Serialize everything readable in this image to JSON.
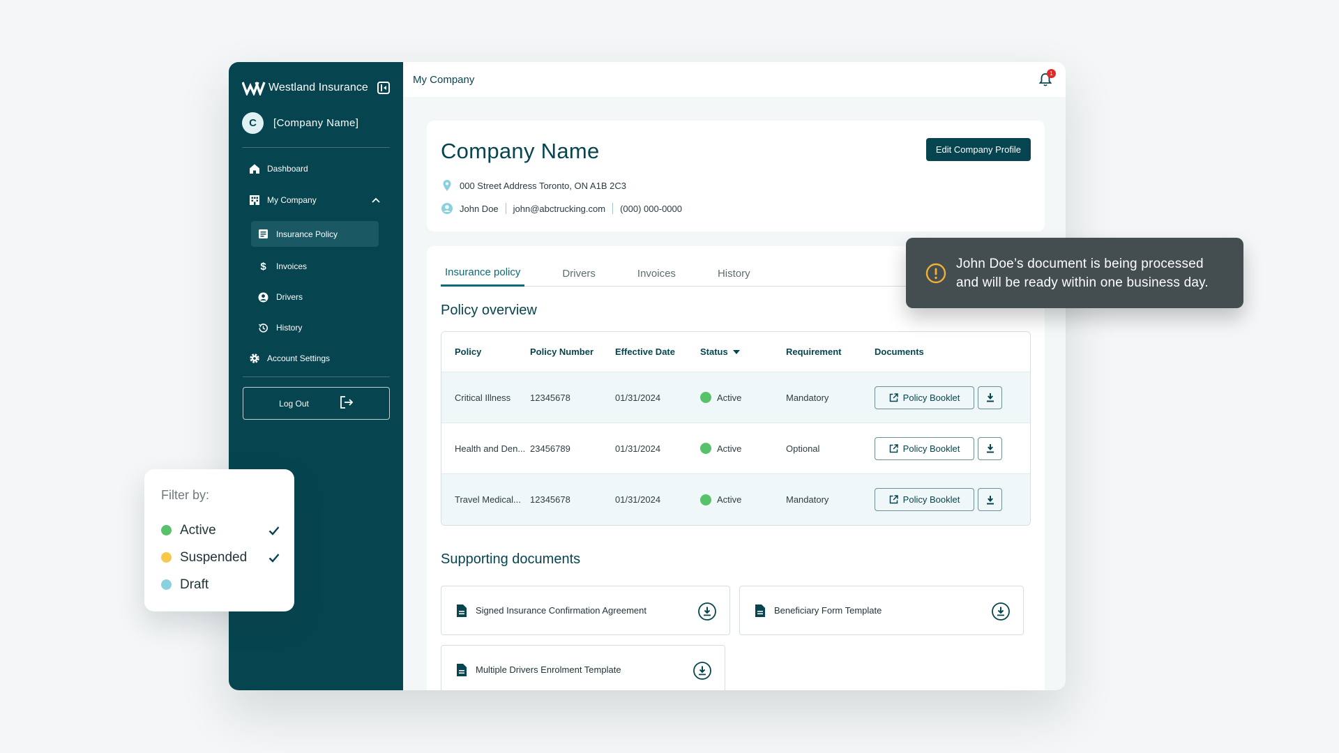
{
  "sidebar": {
    "brand": "Westland Insurance",
    "company_initial": "C",
    "company_name": "[Company Name]",
    "items": [
      {
        "label": "Dashboard"
      },
      {
        "label": "My Company"
      },
      {
        "label": "Insurance Policy"
      },
      {
        "label": "Invoices"
      },
      {
        "label": "Drivers"
      },
      {
        "label": "History"
      },
      {
        "label": "Account Settings"
      }
    ],
    "logout_label": "Log Out"
  },
  "topbar": {
    "title": "My Company",
    "notification_count": "1"
  },
  "profile": {
    "title": "Company Name",
    "edit_label": "Edit Company Profile",
    "address": "000 Street Address Toronto, ON A1B 2C3",
    "contact_name": "John Doe",
    "email": "john@abctrucking.com",
    "phone": "(000) 000-0000"
  },
  "tabs": [
    "Insurance policy",
    "Drivers",
    "Invoices",
    "History"
  ],
  "policy_overview": {
    "title": "Policy overview",
    "headers": [
      "Policy",
      "Policy Number",
      "Effective Date",
      "Status",
      "Requirement",
      "Documents"
    ],
    "rows": [
      {
        "policy": "Critical Illness",
        "number": "12345678",
        "date": "01/31/2024",
        "status": "Active",
        "requirement": "Mandatory",
        "doc": "Policy Booklet"
      },
      {
        "policy": "Health and Den...",
        "number": "23456789",
        "date": "01/31/2024",
        "status": "Active",
        "requirement": "Optional",
        "doc": "Policy Booklet"
      },
      {
        "policy": "Travel Medical...",
        "number": "12345678",
        "date": "01/31/2024",
        "status": "Active",
        "requirement": "Mandatory",
        "doc": "Policy Booklet"
      }
    ]
  },
  "supporting": {
    "title": "Supporting documents",
    "docs": [
      "Signed Insurance Confirmation Agreement",
      "Beneficiary Form Template",
      "Multiple Drivers Enrolment Template"
    ]
  },
  "toast": {
    "line1": "John Doe’s document is being processed",
    "line2": "and will be ready within one business day."
  },
  "filter": {
    "title": "Filter by:",
    "options": [
      {
        "label": "Active",
        "color": "#58c26a",
        "checked": true
      },
      {
        "label": "Suspended",
        "color": "#f7c948",
        "checked": true
      },
      {
        "label": "Draft",
        "color": "#8ad1de",
        "checked": false
      }
    ]
  },
  "colors": {
    "primary": "#06454f",
    "accent": "#0b6a77",
    "active": "#58c26a",
    "warning": "#f2b134"
  }
}
